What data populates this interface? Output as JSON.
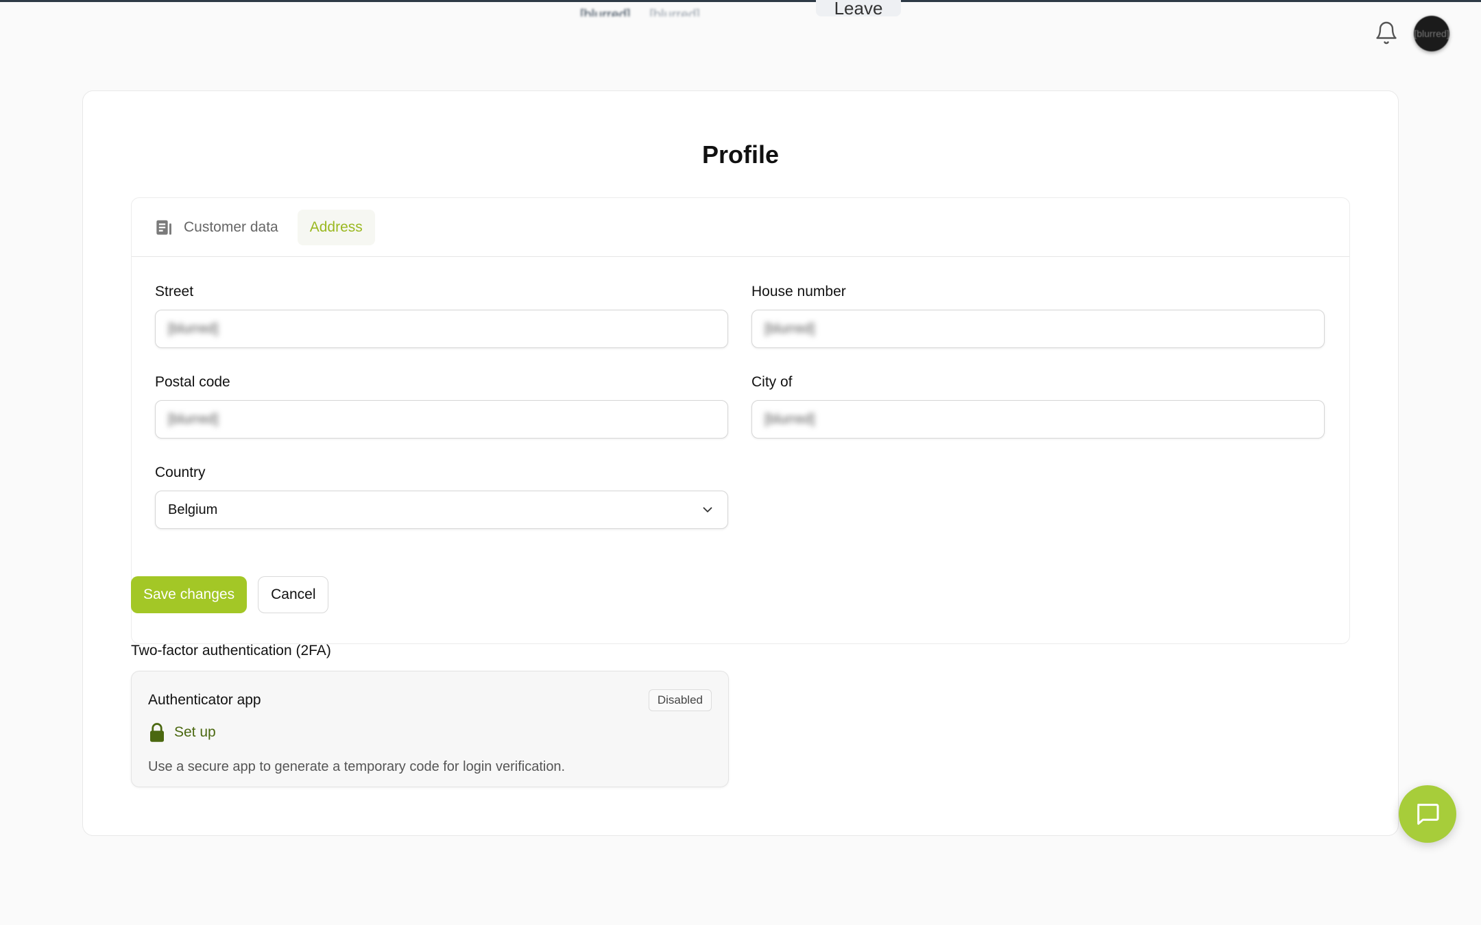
{
  "top": {
    "share_text": "[blurred]",
    "share_text_2": "[blurred]",
    "leave_label": "Leave",
    "avatar_initials": "[blurred]"
  },
  "page": {
    "title": "Profile"
  },
  "tabs": [
    {
      "label": "Customer data",
      "icon": "contact-card-icon",
      "active": false
    },
    {
      "label": "Address",
      "active": true
    }
  ],
  "form": {
    "street": {
      "label": "Street",
      "value": "[blurred]"
    },
    "house_number": {
      "label": "House number",
      "value": "[blurred]"
    },
    "postal_code": {
      "label": "Postal code",
      "value": "[blurred]"
    },
    "city": {
      "label": "City of",
      "value": "[blurred]"
    },
    "country": {
      "label": "Country",
      "value": "Belgium"
    }
  },
  "actions": {
    "save_label": "Save changes",
    "cancel_label": "Cancel"
  },
  "tfa": {
    "heading": "Two-factor authentication (2FA)",
    "card_title": "Authenticator app",
    "status": "Disabled",
    "setup_label": "Set up",
    "description": "Use a secure app to generate a temporary code for login verification."
  },
  "colors": {
    "accent": "#a3c726",
    "accent_dark": "#4b6810",
    "tab_active_text": "#9ab820"
  }
}
